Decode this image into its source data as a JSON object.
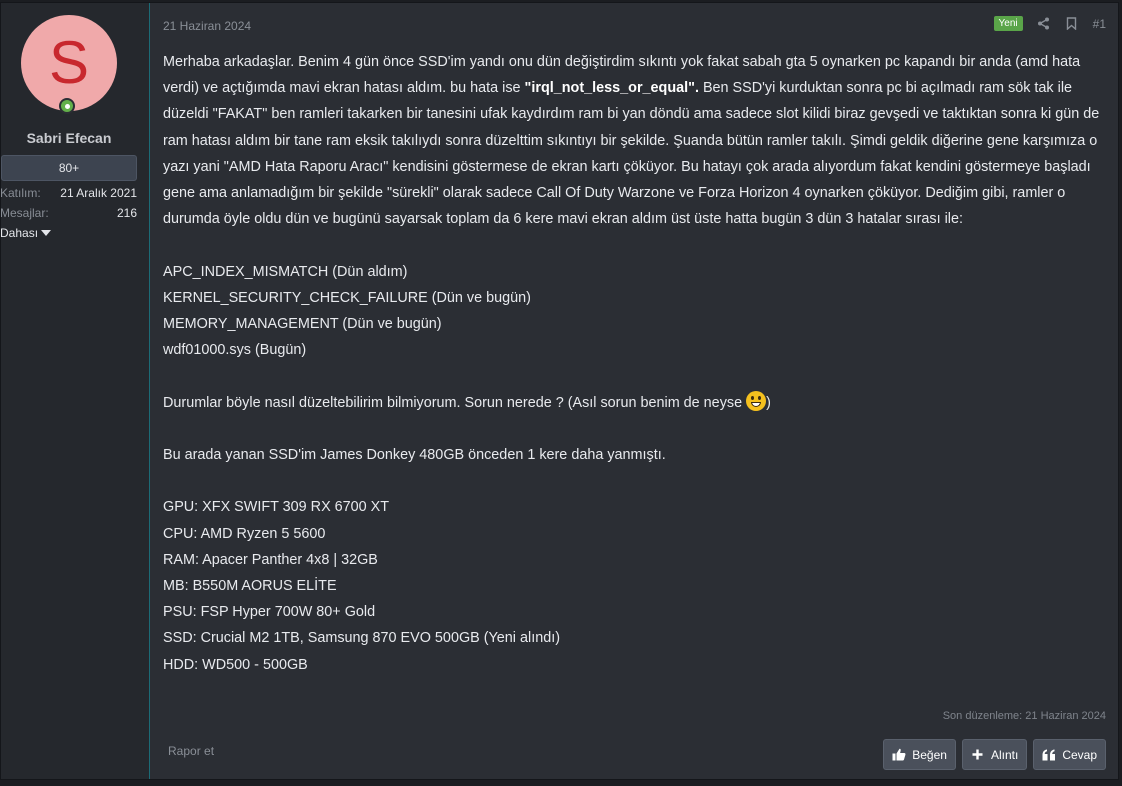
{
  "user": {
    "avatar_letter": "S",
    "name": "Sabri Efecan",
    "badge": "80+",
    "stats": [
      {
        "label": "Katılım:",
        "value": "21 Aralık 2021"
      },
      {
        "label": "Mesajlar:",
        "value": "216"
      }
    ],
    "more_label": "Dahası"
  },
  "post": {
    "date": "21 Haziran 2024",
    "new_badge": "Yeni",
    "number": "#1",
    "paragraph1_part1": "Merhaba arkadaşlar. Benim 4 gün önce SSD'im yandı onu dün değiştirdim sıkıntı yok fakat sabah gta 5 oynarken pc kapandı bir anda (amd hata verdi) ve açtığımda mavi ekran hatası aldım. bu hata ise ",
    "paragraph1_bold": "\"irql_not_less_or_equal\".",
    "paragraph1_part2": " Ben SSD'yi kurduktan sonra pc bi açılmadı ram sök tak ile düzeldi \"FAKAT\" ben ramleri takarken bir tanesini ufak kaydırdım ram bi yan döndü ama sadece slot kilidi biraz gevşedi ve taktıktan sonra ki gün de ram hatası aldım bir tane ram eksik takılıydı sonra düzelttim sıkıntıyı bir şekilde. Şuanda bütün ramler takılı. Şimdi geldik diğerine gene karşımıza o yazı yani \"AMD Hata Raporu Aracı\" kendisini göstermese de ekran kartı çöküyor. Bu hatayı çok arada alıyordum fakat kendini göstermeye başladı gene ama anlamadığım bir şekilde \"sürekli\" olarak sadece Call Of Duty Warzone ve Forza Horizon 4 oynarken çöküyor. Dediğim gibi, ramler o durumda öyle oldu dün ve bugünü sayarsak toplam da 6 kere mavi ekran aldım üst üste hatta bugün 3 dün 3 hatalar sırası ile:",
    "errors": [
      "APC_INDEX_MISMATCH (Dün aldım)",
      "KERNEL_SECURITY_CHECK_FAILURE (Dün ve bugün)",
      "MEMORY_MANAGEMENT (Dün ve bugün)",
      "wdf01000.sys (Bugün)"
    ],
    "question_text": "Durumlar böyle nasıl düzeltebilirim bilmiyorum. Sorun nerede ? (Asıl sorun benim de neyse ",
    "question_end": ")",
    "ssd_note": "Bu arada yanan SSD'im James Donkey 480GB önceden 1 kere daha yanmıştı.",
    "specs": [
      "GPU: XFX SWIFT 309 RX 6700 XT",
      "CPU: AMD Ryzen 5 5600",
      "RAM: Apacer Panther 4x8 | 32GB",
      "MB: B550M AORUS ELİTE",
      "PSU: FSP Hyper 700W 80+ Gold",
      "SSD: Crucial M2 1TB, Samsung 870 EVO 500GB (Yeni alındı)",
      "HDD: WD500 - 500GB"
    ],
    "edited": "Son düzenleme: 21 Haziran 2024"
  },
  "footer": {
    "report": "Rapor et",
    "like": "Beğen",
    "quote": "Alıntı",
    "reply": "Cevap"
  },
  "colors": {
    "avatar_bg": "#f0a9aa",
    "avatar_letter": "#c8282e",
    "new_badge": "#5aa549",
    "online": "#63b04a"
  },
  "icons": [
    "share-icon",
    "bookmark-icon",
    "thumbs-up-icon",
    "plus-icon",
    "quote-icon",
    "caret-down-icon",
    "smiley-icon"
  ]
}
